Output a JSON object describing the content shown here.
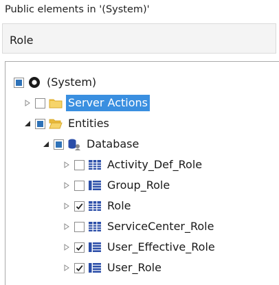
{
  "panel": {
    "title": "Public elements in '(System)'",
    "search_value": "Role"
  },
  "colors": {
    "selection": "#3a8fe0",
    "checkbox_fill": "#2e72b8",
    "folder": "#f2c94c",
    "entity_icon": "#2b4ea8"
  },
  "tree": {
    "root": {
      "label": "(System)",
      "icon": "module-icon",
      "state": "partial"
    },
    "server_actions": {
      "label": "Server Actions",
      "icon": "folder-icon",
      "state": "unchecked",
      "selected": true
    },
    "entities": {
      "label": "Entities",
      "icon": "folder-open-icon",
      "state": "partial",
      "expanded": true
    },
    "database": {
      "label": "Database",
      "icon": "database-icon",
      "state": "partial",
      "expanded": true
    },
    "items": [
      {
        "label": "Activity_Def_Role",
        "icon": "static-entity-icon",
        "state": "unchecked"
      },
      {
        "label": "Group_Role",
        "icon": "entity-icon",
        "state": "unchecked"
      },
      {
        "label": "Role",
        "icon": "static-entity-icon",
        "state": "checked"
      },
      {
        "label": "ServiceCenter_Role",
        "icon": "static-entity-icon",
        "state": "unchecked"
      },
      {
        "label": "User_Effective_Role",
        "icon": "entity-icon",
        "state": "checked"
      },
      {
        "label": "User_Role",
        "icon": "entity-icon",
        "state": "checked"
      }
    ]
  }
}
